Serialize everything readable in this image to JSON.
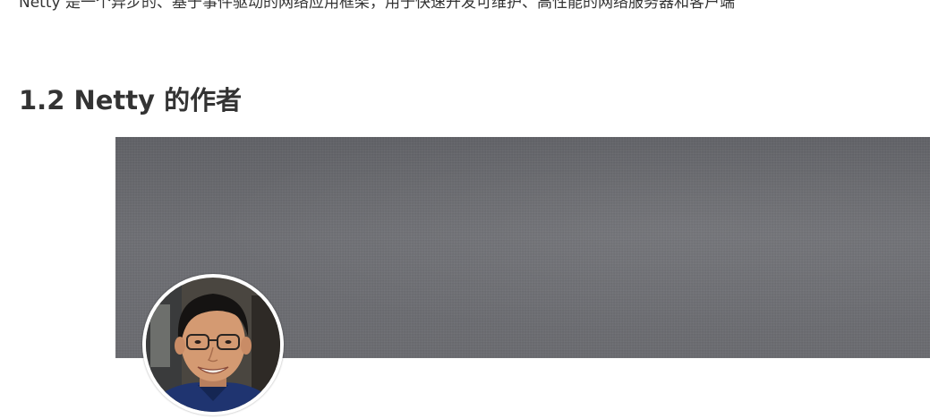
{
  "intro_text": "Netty 是一个异步的、基于事件驱动的网络应用框架，用于快速开发可维护、高性能的网络服务器和客户端",
  "section": {
    "heading": "1.2 Netty 的作者"
  },
  "profile": {
    "cover": "gray-textured-cover-image",
    "avatar": "author-portrait-photo"
  }
}
